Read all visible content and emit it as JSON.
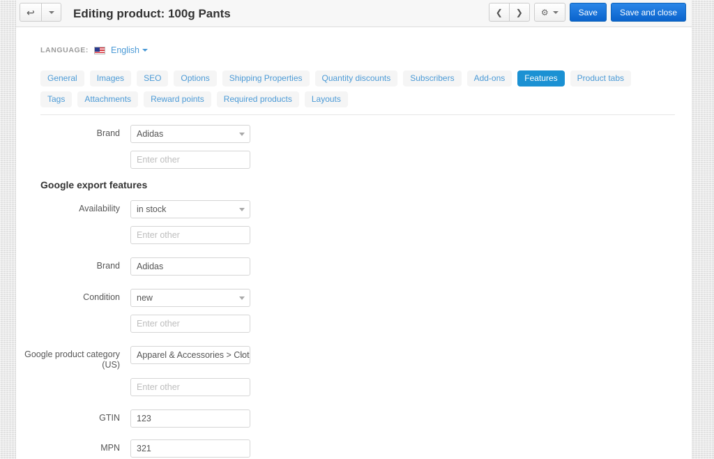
{
  "toolbar": {
    "back_icon": "back-arrow-icon",
    "back_dropdown_icon": "caret-down-icon",
    "title": "Editing product: 100g Pants",
    "prev_icon": "chevron-left-icon",
    "next_icon": "chevron-right-icon",
    "settings_icon": "gear-icon",
    "settings_caret_icon": "caret-down-icon",
    "save_label": "Save",
    "save_and_close_label": "Save and close"
  },
  "language": {
    "label": "LANGUAGE:",
    "flag_icon": "us-flag-icon",
    "value": "English",
    "caret_icon": "caret-down-icon"
  },
  "tabs": [
    {
      "label": "General",
      "active": false
    },
    {
      "label": "Images",
      "active": false
    },
    {
      "label": "SEO",
      "active": false
    },
    {
      "label": "Options",
      "active": false
    },
    {
      "label": "Shipping Properties",
      "active": false
    },
    {
      "label": "Quantity discounts",
      "active": false
    },
    {
      "label": "Subscribers",
      "active": false
    },
    {
      "label": "Add-ons",
      "active": false
    },
    {
      "label": "Features",
      "active": true
    },
    {
      "label": "Product tabs",
      "active": false
    },
    {
      "label": "Tags",
      "active": false
    },
    {
      "label": "Attachments",
      "active": false
    },
    {
      "label": "Reward points",
      "active": false
    },
    {
      "label": "Required products",
      "active": false
    },
    {
      "label": "Layouts",
      "active": false
    }
  ],
  "form": {
    "brand": {
      "label": "Brand",
      "value": "Adidas",
      "other_placeholder": "Enter other",
      "other_value": ""
    },
    "google_section_heading": "Google export features",
    "availability": {
      "label": "Availability",
      "value": "in stock",
      "other_placeholder": "Enter other",
      "other_value": ""
    },
    "google_brand": {
      "label": "Brand",
      "value": "Adidas"
    },
    "condition": {
      "label": "Condition",
      "value": "new",
      "other_placeholder": "Enter other",
      "other_value": ""
    },
    "google_product_category": {
      "label_line1": "Google product category",
      "label_line2": "(US)",
      "value": "Apparel & Accessories > Cloth...",
      "other_placeholder": "Enter other",
      "other_value": ""
    },
    "gtin": {
      "label": "GTIN",
      "value": "123"
    },
    "mpn": {
      "label": "MPN",
      "value": "321"
    }
  },
  "colors": {
    "accent_blue": "#1b91d3",
    "link_blue": "#4b9ad6",
    "primary_button": "#0a63cc",
    "page_background": "#ffffff",
    "toolbar_background": "#f7f7f7"
  }
}
